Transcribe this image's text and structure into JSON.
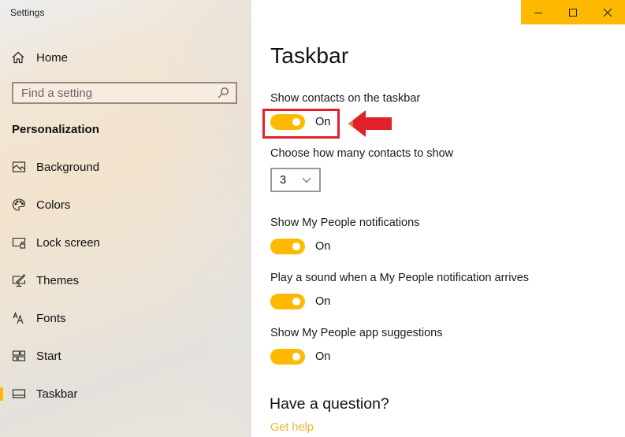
{
  "window": {
    "app_title": "Settings",
    "controls": {
      "minimize": "minimize-icon",
      "maximize": "maximize-icon",
      "close": "close-icon"
    },
    "accent_color": "#ffb900"
  },
  "sidebar": {
    "home_label": "Home",
    "search_placeholder": "Find a setting",
    "search_value": "",
    "section_title": "Personalization",
    "items": [
      {
        "label": "Background",
        "icon": "picture-icon",
        "selected": false
      },
      {
        "label": "Colors",
        "icon": "palette-icon",
        "selected": false
      },
      {
        "label": "Lock screen",
        "icon": "lock-screen-icon",
        "selected": false
      },
      {
        "label": "Themes",
        "icon": "themes-icon",
        "selected": false
      },
      {
        "label": "Fonts",
        "icon": "fonts-icon",
        "selected": false
      },
      {
        "label": "Start",
        "icon": "start-icon",
        "selected": false
      },
      {
        "label": "Taskbar",
        "icon": "taskbar-icon",
        "selected": true
      }
    ]
  },
  "main": {
    "title": "Taskbar",
    "settings": [
      {
        "label": "Show contacts on the taskbar",
        "type": "toggle",
        "state": "On",
        "highlighted": true
      },
      {
        "label": "Choose how many contacts to show",
        "type": "dropdown",
        "value": "3"
      },
      {
        "label": "Show My People notifications",
        "type": "toggle",
        "state": "On"
      },
      {
        "label": "Play a sound when a My People notification arrives",
        "type": "toggle",
        "state": "On"
      },
      {
        "label": "Show My People app suggestions",
        "type": "toggle",
        "state": "On"
      }
    ],
    "question_title": "Have a question?",
    "help_link": "Get help",
    "annotation_color": "#e0202a"
  }
}
